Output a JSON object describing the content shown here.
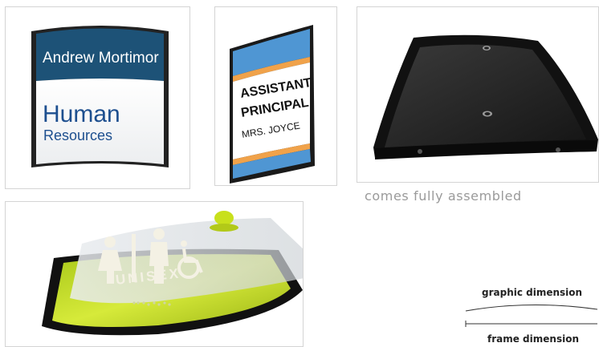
{
  "sign_1": {
    "name": "Andrew Mortimor",
    "department_line1": "Human",
    "department_line2": "Resources"
  },
  "sign_2": {
    "title_line1": "ASSISTANT",
    "title_line2": "PRINCIPAL",
    "name": "MRS. JOYCE"
  },
  "sign_4": {
    "label": "UNISEX"
  },
  "caption": "comes fully assembled",
  "dimensions": {
    "graphic_label": "graphic dimension",
    "frame_label": "frame dimension"
  },
  "colors": {
    "sign_blue": "#1d5277",
    "department_text": "#1d4f8f",
    "principal_blue": "#4f96d3",
    "principal_orange": "#f0a24a",
    "frame_black": "#1a1a1a",
    "lime_insert": "#c8e01c",
    "caption_gray": "#9a9a9a"
  }
}
